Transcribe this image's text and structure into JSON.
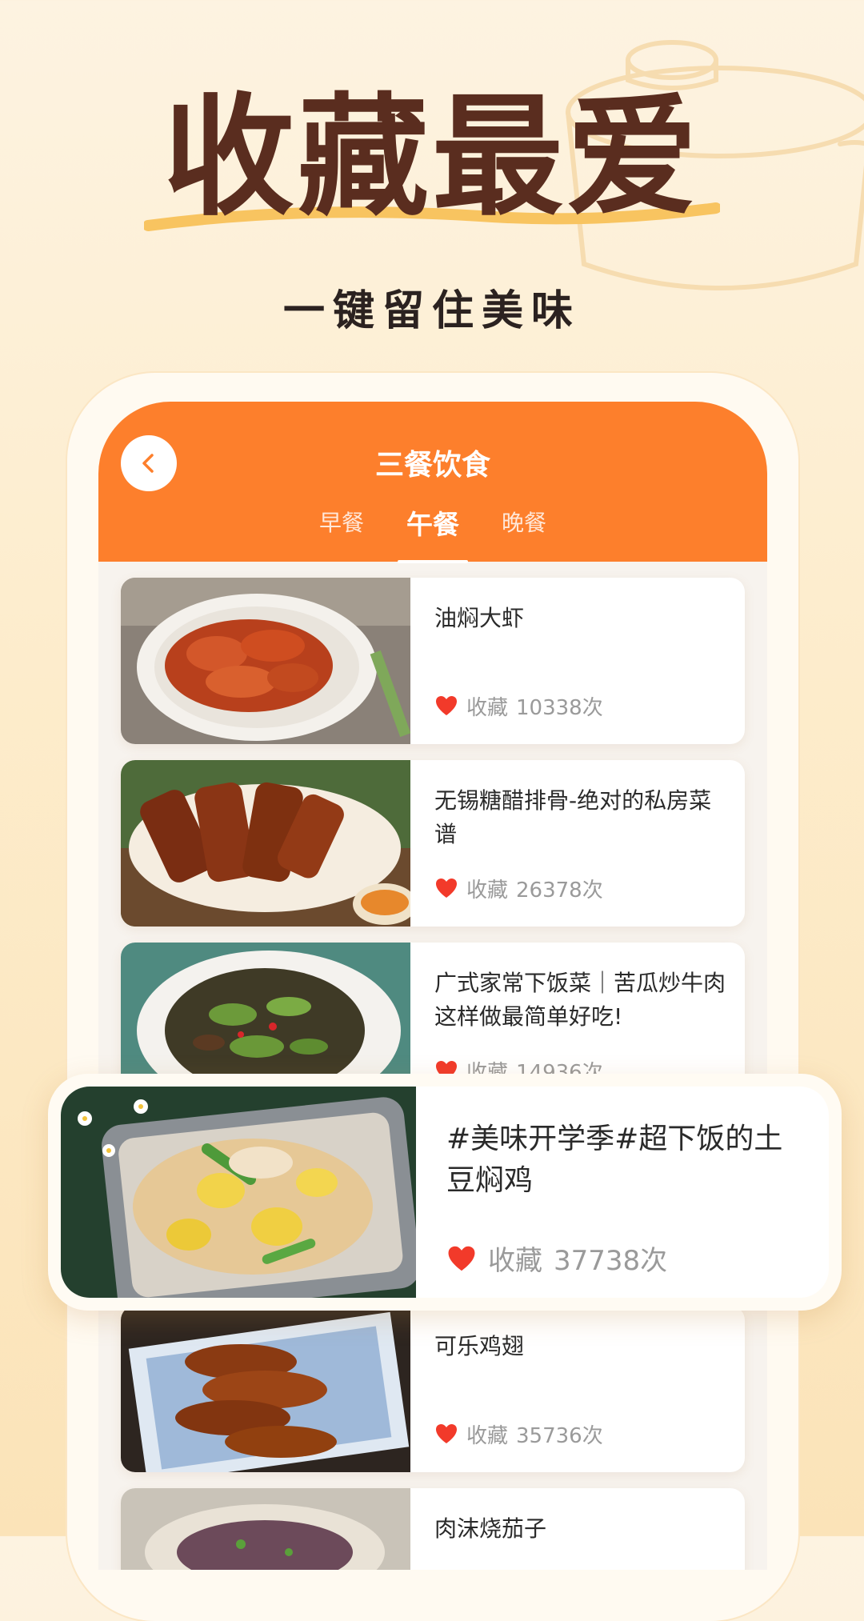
{
  "hero": {
    "title": "收藏最爱",
    "subtitle": "一键留住美味"
  },
  "app": {
    "title": "三餐饮食",
    "tabs": [
      {
        "label": "早餐",
        "active": false
      },
      {
        "label": "午餐",
        "active": true
      },
      {
        "label": "晚餐",
        "active": false
      }
    ],
    "fav_label": "收藏"
  },
  "recipes": [
    {
      "title": "油焖大虾",
      "count": "10338次"
    },
    {
      "title": "无锡糖醋排骨-绝对的私房菜谱",
      "count": "26378次"
    },
    {
      "title": "广式家常下饭菜｜苦瓜炒牛肉这样做最简单好吃!",
      "count": "14936次"
    },
    {
      "title": "可乐鸡翅",
      "count": "35736次"
    },
    {
      "title": "肉沫烧茄子",
      "count": ""
    }
  ],
  "highlight": {
    "title": "#美味开学季#超下饭的土豆焖鸡",
    "count": "37738次"
  },
  "colors": {
    "brand": "#fd7f2c",
    "title_brown": "#5a2d1f",
    "heart": "#f23a2a"
  }
}
